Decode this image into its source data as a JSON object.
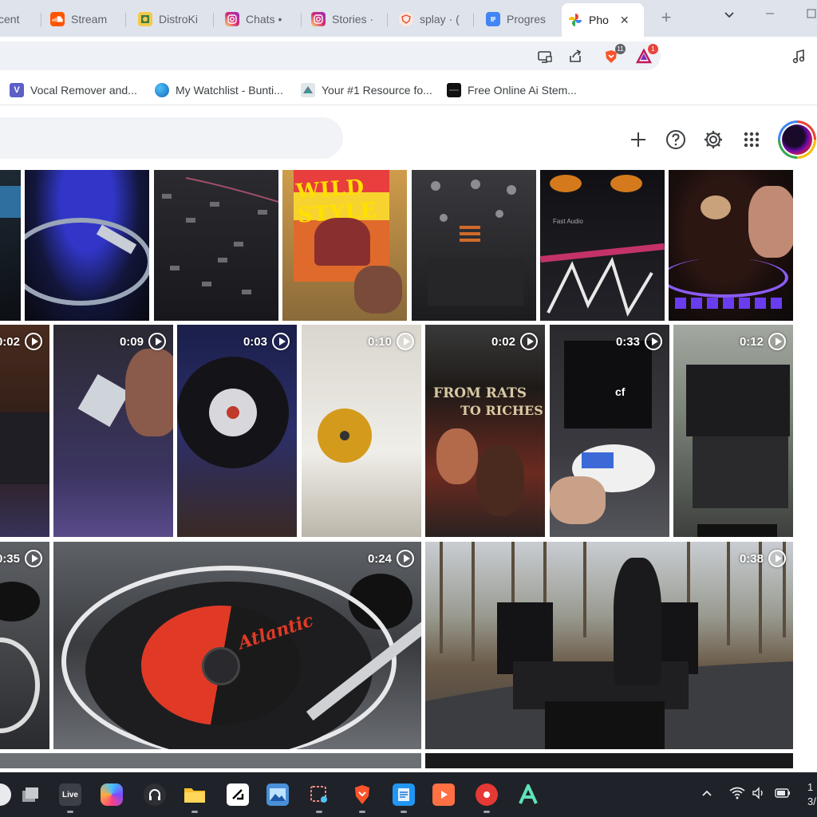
{
  "tabs": [
    {
      "label": "cent",
      "icon": "generic-tab-icon"
    },
    {
      "label": "Stream",
      "icon": "soundcloud-icon"
    },
    {
      "label": "DistroKi",
      "icon": "distrokid-icon"
    },
    {
      "label": "Chats •",
      "icon": "instagram-icon"
    },
    {
      "label": "Stories ·",
      "icon": "instagram-icon"
    },
    {
      "label": "splay · (",
      "icon": "brave-shield-icon"
    },
    {
      "label": "Progres",
      "icon": "google-docs-icon"
    },
    {
      "label": "Pho",
      "icon": "google-photos-icon",
      "active": true
    }
  ],
  "toolbar": {
    "brave_badge": "11",
    "rewards_badge": "1"
  },
  "bookmarks": [
    {
      "label": "Vocal Remover and...",
      "icon": "V"
    },
    {
      "label": "My Watchlist - Bunti...",
      "icon": "globe"
    },
    {
      "label": "Your #1 Resource fo...",
      "icon": "resource"
    },
    {
      "label": "Free Online Ai Stem...",
      "icon": "stem"
    }
  ],
  "photos": {
    "row2_durations": [
      "0:02",
      "0:09",
      "0:03",
      "0:10",
      "0:02",
      "0:33",
      "0:12"
    ],
    "row3_durations": [
      "0:35",
      "0:24",
      "0:38"
    ],
    "album_texts": {
      "wild_style": "WILD STYLE",
      "from_rats": "FROM RATS",
      "to_riches": "TO RICHES",
      "atlantic": "Atlantic",
      "fast_audio": "Fast Audio"
    }
  },
  "taskbar": {
    "live_label": "Live",
    "clock_top": "1",
    "clock_bottom": "3/"
  }
}
